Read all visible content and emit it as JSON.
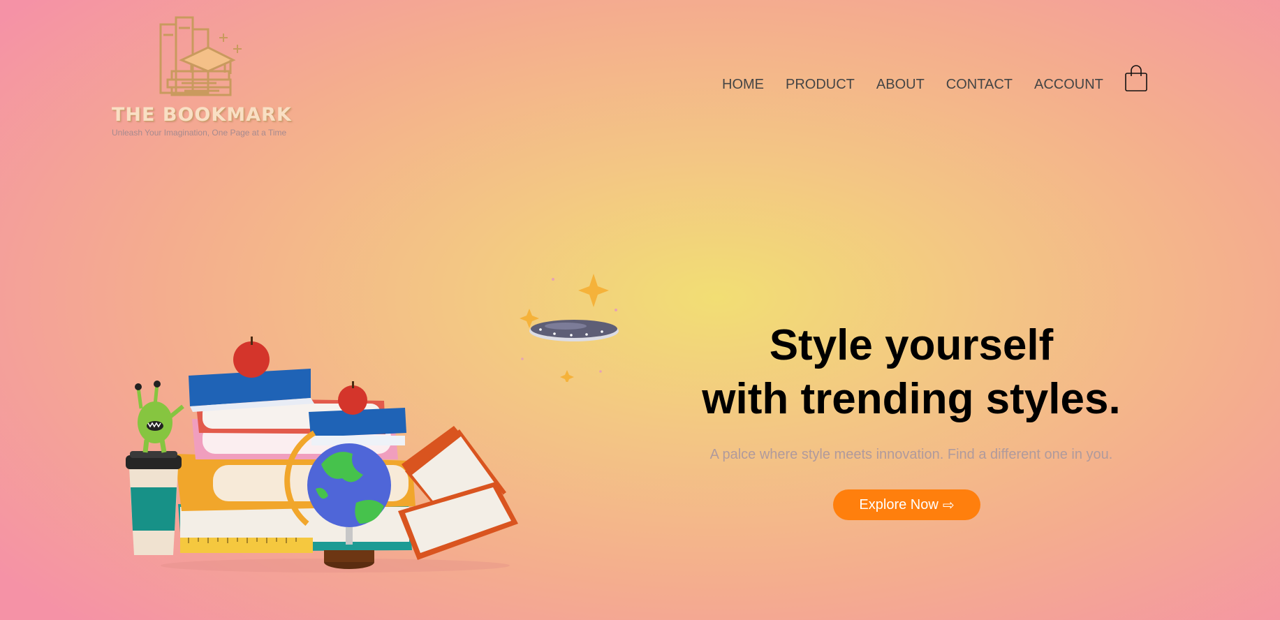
{
  "brand": {
    "name": "THE BOOKMARK",
    "tagline": "Unleash Your Imagination, One Page at a Time"
  },
  "nav": {
    "items": [
      {
        "label": "HOME"
      },
      {
        "label": "PRODUCT"
      },
      {
        "label": "ABOUT"
      },
      {
        "label": "CONTACT"
      },
      {
        "label": "ACCOUNT"
      }
    ],
    "cart_icon": "shopping-bag-icon"
  },
  "hero": {
    "title_line1": "Style yourself",
    "title_line2": "with trending styles.",
    "subtitle": "A palce where style meets innovation. Find a different one in you.",
    "cta_label": "Explore Now",
    "cta_icon": "⇨"
  },
  "illustrations": {
    "ufo": "ufo-with-stars-illustration",
    "books": "book-stack-with-globe-illustration"
  },
  "colors": {
    "accent": "#ff7f0d",
    "logo": "#c99a5e",
    "nav_text": "#454545",
    "subtitle": "#b09a9c"
  }
}
